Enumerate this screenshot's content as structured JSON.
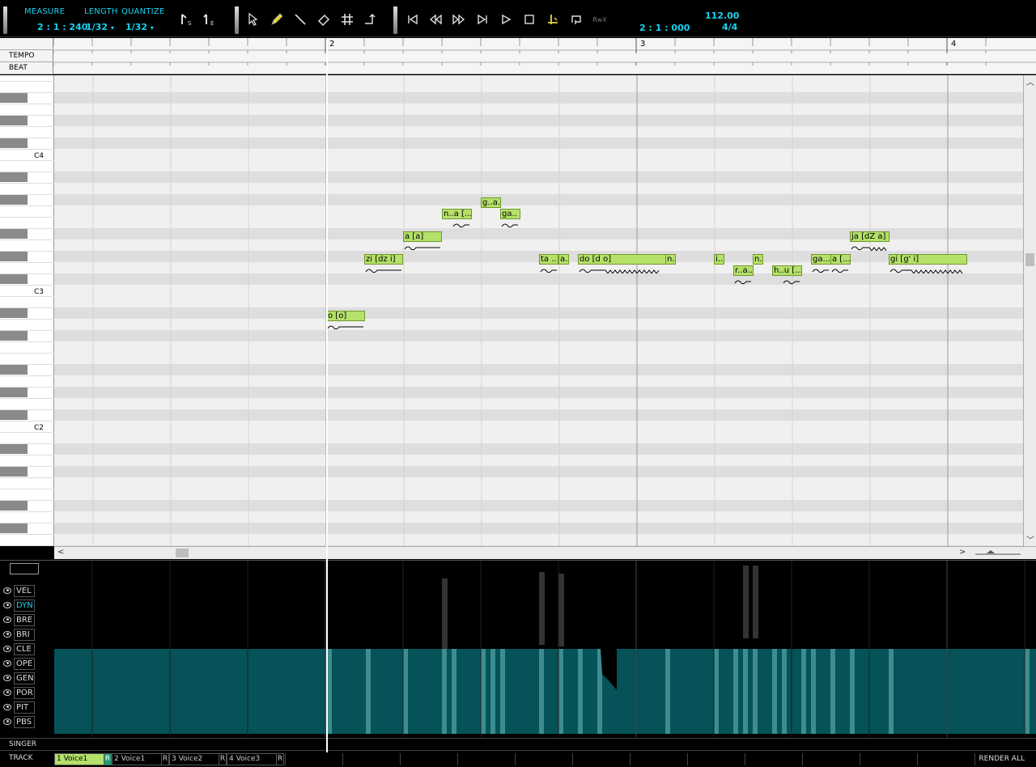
{
  "toolbar": {
    "measure_label": "MEASURE",
    "measure_value": "2 : 1 : 240",
    "length_label": "LENGTH",
    "length_value": "1/32",
    "quantize_label": "QUANTIZE",
    "quantize_value": "1/32",
    "song_position": "2 : 1 : 000",
    "tempo": "112.00",
    "time_signature": "4/4",
    "accent_color": "#19d3f0",
    "tools": [
      "start-marker-icon",
      "end-marker-icon",
      "arrow-tool-icon",
      "pencil-tool-icon",
      "line-tool-icon",
      "eraser-tool-icon",
      "grid-snap-icon",
      "auto-scroll-icon"
    ],
    "transport": [
      "go-to-start-icon",
      "rewind-icon",
      "fast-forward-icon",
      "go-to-end-icon",
      "play-icon",
      "stop-icon",
      "record-icon",
      "loop-icon",
      "rewire-icon"
    ],
    "rewire_label": "RwX"
  },
  "ruler": {
    "tempo_label": "TEMPO",
    "beat_label": "BEAT",
    "bars": [
      "2",
      "3",
      "4"
    ]
  },
  "keyboard": {
    "labels": [
      "C4",
      "C3",
      "C2"
    ]
  },
  "notes": [
    {
      "lyric": "o [o]"
    },
    {
      "lyric": "zi [dz i]"
    },
    {
      "lyric": "a [a]"
    },
    {
      "lyric": "n..a [..."
    },
    {
      "lyric": "g..a.."
    },
    {
      "lyric": "ga.."
    },
    {
      "lyric": "ta .."
    },
    {
      "lyric": "a.."
    },
    {
      "lyric": "do [d o]"
    },
    {
      "lyric": "n.."
    },
    {
      "lyric": "i.."
    },
    {
      "lyric": "r..a.."
    },
    {
      "lyric": "n.."
    },
    {
      "lyric": "h..u [..."
    },
    {
      "lyric": "ga..."
    },
    {
      "lyric": "a [..."
    },
    {
      "lyric": "ja [dZ a]"
    },
    {
      "lyric": "gi [g' i]"
    }
  ],
  "note_color": "#b5e06a",
  "controls": {
    "items": [
      "VEL",
      "DYN",
      "BRE",
      "BRI",
      "CLE",
      "OPE",
      "GEN",
      "POR",
      "PIT",
      "PBS"
    ],
    "active": "DYN",
    "dyn_fill_color": "#055258"
  },
  "singer_label": "SINGER",
  "track_label": "TRACK",
  "tracks": [
    {
      "label": "1 Voice1",
      "r": "R",
      "active": true
    },
    {
      "label": "2 Voice1",
      "r": "R",
      "active": false
    },
    {
      "label": "3 Voice2",
      "r": "R",
      "active": false
    },
    {
      "label": "4 Voice3",
      "r": "R",
      "active": false
    }
  ],
  "render_all_label": "RENDER ALL"
}
